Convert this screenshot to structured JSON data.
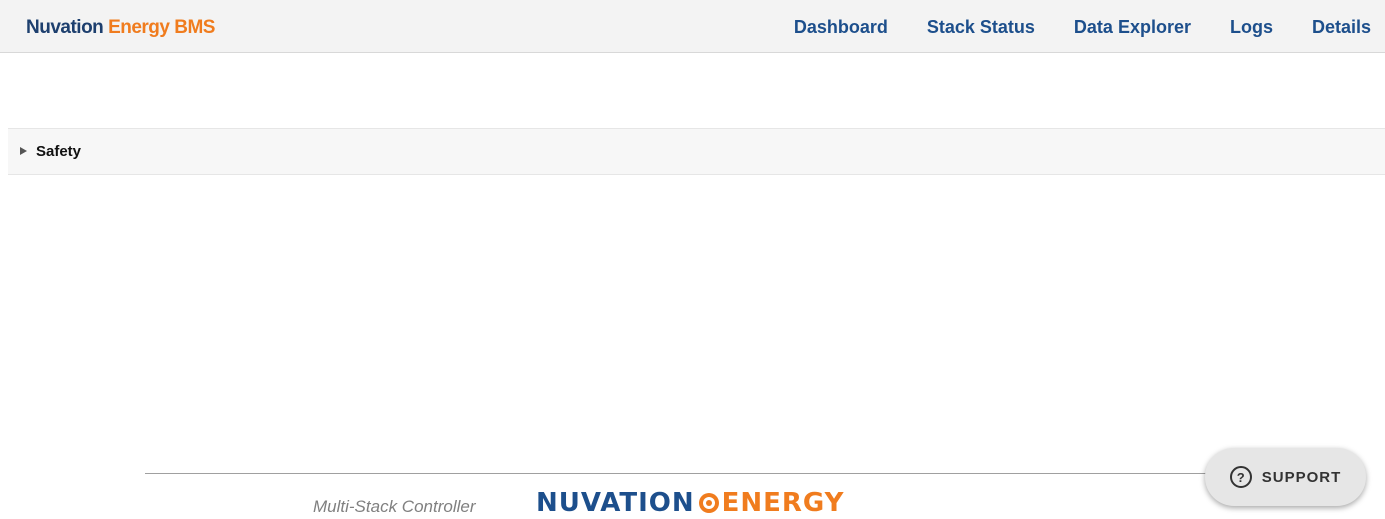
{
  "header": {
    "brand_part1": "Nuvation",
    "brand_part2": "Energy BMS",
    "nav": [
      {
        "label": "Dashboard"
      },
      {
        "label": "Stack Status"
      },
      {
        "label": "Data Explorer"
      },
      {
        "label": "Logs"
      },
      {
        "label": "Details"
      }
    ]
  },
  "sections": [
    {
      "title": "Safety",
      "icon": "caret-right-icon",
      "expanded": false
    }
  ],
  "footer": {
    "product": "Multi-Stack Controller",
    "logo_part1": "NUVATION",
    "logo_part2": "ENERGY"
  },
  "support": {
    "label": "SUPPORT",
    "icon": "question-circle-icon"
  },
  "colors": {
    "brand_navy": "#1d3f6e",
    "brand_orange": "#f07c1e",
    "nav_blue": "#1d4f8c"
  }
}
